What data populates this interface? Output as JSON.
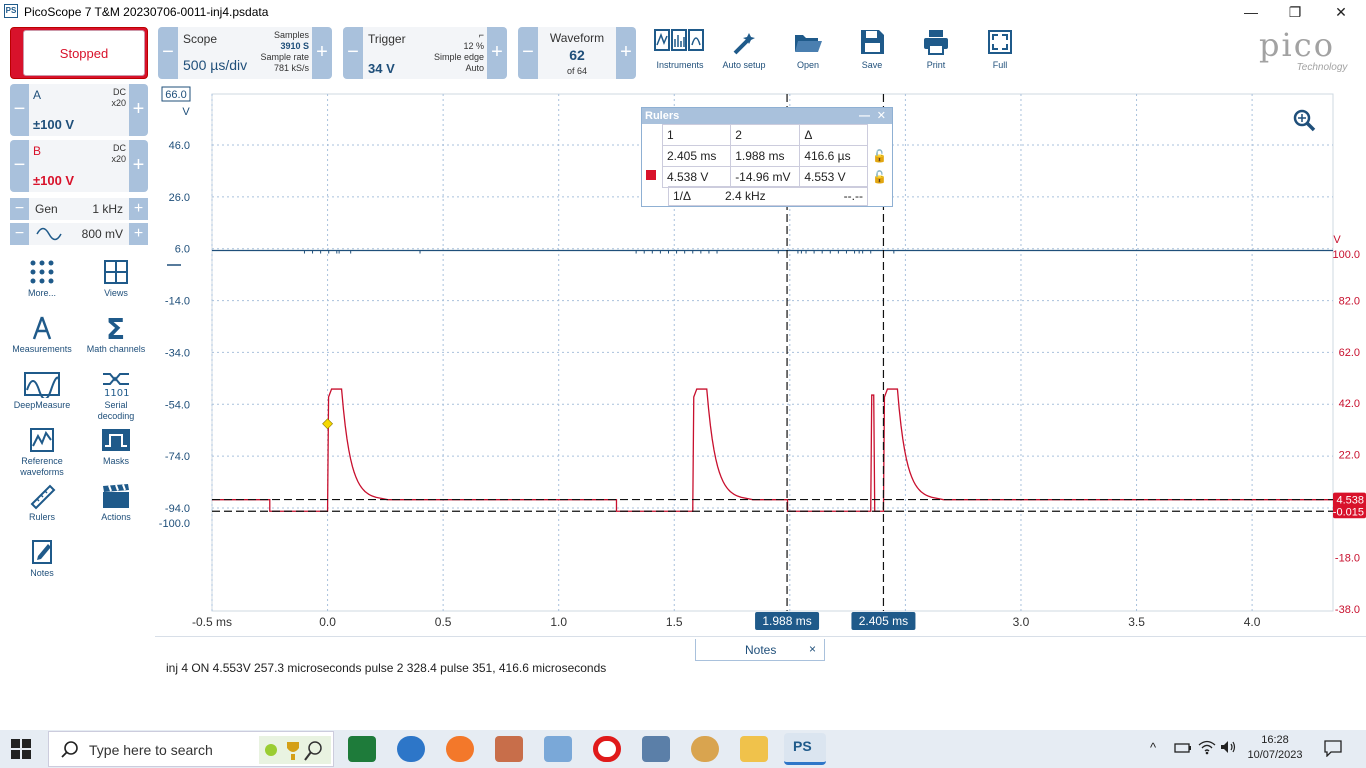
{
  "window": {
    "title": "PicoScope 7 T&M 20230706-0011-inj4.psdata",
    "app_icon": "PS",
    "minimize": "—",
    "restore": "❐",
    "close": "✕"
  },
  "toolbar": {
    "run_state": "Stopped",
    "scope": {
      "label": "Scope",
      "value": "500 µs/div",
      "samples_label": "Samples",
      "samples": "3910 S",
      "rate_label": "Sample rate",
      "rate": "781 kS/s"
    },
    "trigger": {
      "label": "Trigger",
      "value": "34 V",
      "percent": "12 %",
      "type": "Simple edge",
      "mode": "Auto"
    },
    "waveform": {
      "label": "Waveform",
      "value": "62",
      "of": "of 64"
    },
    "tools": [
      "Instruments",
      "Auto setup",
      "Open",
      "Save",
      "Print",
      "Full"
    ],
    "logo": {
      "word": "pico",
      "sub": "Technology"
    }
  },
  "channels": [
    {
      "name": "A",
      "range": "±100 V",
      "coupling": "DC",
      "probe": "x20",
      "color": "#1f4f7a"
    },
    {
      "name": "B",
      "range": "±100 V",
      "coupling": "DC",
      "probe": "x20",
      "color": "#d8122b"
    }
  ],
  "generator": {
    "label": "Gen",
    "freq": "1 kHz",
    "amp": "800 mV"
  },
  "sidebar_tools": [
    "More...",
    "Views",
    "Measurements",
    "Math channels",
    "DeepMeasure",
    "Serial decoding",
    "Reference waveforms",
    "Masks",
    "Rulers",
    "Actions",
    "Notes"
  ],
  "plot": {
    "left_axis_unit": "V",
    "left_top_value": "66.0",
    "left_ticks": [
      "46.0",
      "26.0",
      "6.0",
      "-14.0",
      "-34.0",
      "-54.0",
      "-74.0",
      "-94.0"
    ],
    "left_bottom_value": "-100.0",
    "right_axis_unit": "V",
    "right_ticks": [
      "100.0",
      "82.0",
      "62.0",
      "42.0",
      "22.0",
      "2.0",
      "-18.0",
      "-38.0"
    ],
    "x_ticks": [
      "-0.5 ms",
      "0.0",
      "0.5",
      "1.0",
      "1.5",
      "2.0",
      "2.5",
      "3.0",
      "3.5",
      "4.0"
    ],
    "ruler_h1": "4.538",
    "ruler_h2": "-0.015",
    "ruler_v1": "1.988 ms",
    "ruler_v2": "2.405 ms",
    "x_range_ms": [
      -0.5,
      4.35
    ],
    "channel_b_trace": {
      "baseline_v": 4.5,
      "low_v": 0.0,
      "pulse_peak_v": 47.5,
      "pulse_starts_ms": [
        0.0,
        1.58,
        2.405
      ],
      "pre_low_starts_ms": [
        -0.25,
        1.25,
        1.99
      ],
      "spike_ms": 2.35
    },
    "trigger_marker_v": 34,
    "trigger_marker_color": "#f5d800"
  },
  "rulers_panel": {
    "title": "Rulers",
    "header": [
      "1",
      "2",
      "Δ"
    ],
    "time_row": [
      "2.405 ms",
      "1.988 ms",
      "416.6 µs"
    ],
    "volt_row": [
      "4.538 V",
      "-14.96 mV",
      "4.553 V"
    ],
    "freq_label": "1/Δ",
    "freq": "2.4 kHz",
    "freq_extra": "--.--"
  },
  "notes": {
    "tab_label": "Notes",
    "tab_close": "×",
    "text": "inj 4  ON 4.553V 257.3 microseconds pulse 2 328.4 pulse 351, 416.6 microseconds"
  },
  "taskbar": {
    "search_placeholder": "Type here to search",
    "time": "16:28",
    "date": "10/07/2023"
  }
}
